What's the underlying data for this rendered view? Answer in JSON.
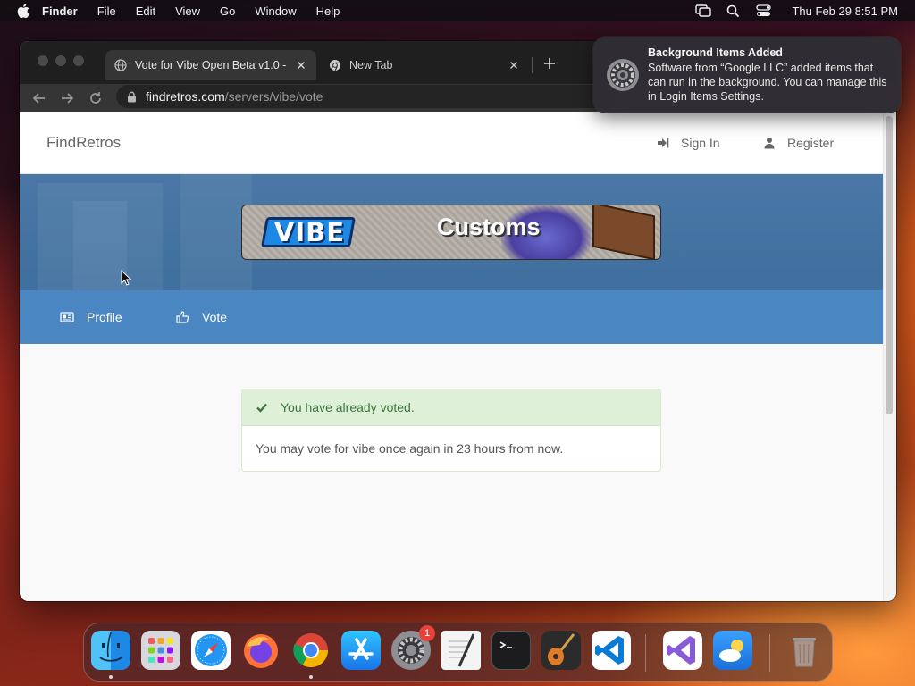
{
  "menubar": {
    "app_name": "Finder",
    "items": [
      "File",
      "Edit",
      "View",
      "Go",
      "Window",
      "Help"
    ],
    "clock": "Thu Feb 29  8:51 PM"
  },
  "browser": {
    "tabs": [
      {
        "title": "Vote for Vibe Open Beta v1.0 -",
        "favicon": "globe-icon",
        "active": true
      },
      {
        "title": "New Tab",
        "favicon": "chrome-icon",
        "active": false
      }
    ],
    "address": {
      "host": "findretros.com",
      "path": "/servers/vibe/vote"
    }
  },
  "site": {
    "brand": "FindRetros",
    "nav": {
      "sign_in": "Sign In",
      "register": "Register"
    },
    "banner": {
      "logo_text": "VIBE",
      "tagline": "Customs"
    },
    "sub_nav": {
      "profile": "Profile",
      "vote": "Vote"
    },
    "vote_status": {
      "header": "You have already voted.",
      "message": "You may vote for vibe once again in 23 hours from now."
    }
  },
  "notification": {
    "title": "Background Items Added",
    "text": "Software from “Google LLC” added items that can run in the background. You can manage this in Login Items Settings."
  },
  "dock": {
    "apps": [
      "Finder",
      "Launchpad",
      "Safari",
      "Firefox",
      "Chrome",
      "App Store",
      "System Settings",
      "TextEdit",
      "Terminal",
      "GarageBand",
      "Visual Studio Code",
      "Visual Studio",
      "Weather",
      "Trash"
    ],
    "settings_badge": "1"
  },
  "colors": {
    "hero_blue": "#4a77a6",
    "subnav_blue": "#4a86c2",
    "success_bg": "#dff0d8",
    "success_text": "#3c763d"
  }
}
